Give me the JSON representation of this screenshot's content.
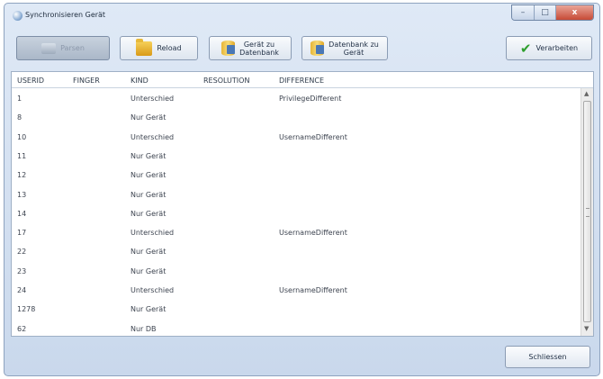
{
  "window": {
    "title": "Synchronisieren Gerät"
  },
  "titlebar": {
    "minimize": "–",
    "maximize": "□",
    "close": "x"
  },
  "toolbar": {
    "disabled_label": "Parsen",
    "reload_label": "Reload",
    "device_to_db_label": [
      "Gerät zu",
      "Datenbank"
    ],
    "db_to_device_label": [
      "Datenbank zu",
      "Gerät"
    ],
    "process_label": "Verarbeiten"
  },
  "table": {
    "headers": [
      "USERID",
      "FINGER",
      "KIND",
      "RESOLUTION",
      "DIFFERENCE"
    ],
    "rows": [
      {
        "userid": "1",
        "finger": "",
        "kind": "Unterschied",
        "resolution": "",
        "difference": "PrivilegeDifferent"
      },
      {
        "userid": "8",
        "finger": "",
        "kind": "Nur Gerät",
        "resolution": "",
        "difference": ""
      },
      {
        "userid": "10",
        "finger": "",
        "kind": "Unterschied",
        "resolution": "",
        "difference": "UsernameDifferent"
      },
      {
        "userid": "11",
        "finger": "",
        "kind": "Nur Gerät",
        "resolution": "",
        "difference": ""
      },
      {
        "userid": "12",
        "finger": "",
        "kind": "Nur Gerät",
        "resolution": "",
        "difference": ""
      },
      {
        "userid": "13",
        "finger": "",
        "kind": "Nur Gerät",
        "resolution": "",
        "difference": ""
      },
      {
        "userid": "14",
        "finger": "",
        "kind": "Nur Gerät",
        "resolution": "",
        "difference": ""
      },
      {
        "userid": "17",
        "finger": "",
        "kind": "Unterschied",
        "resolution": "",
        "difference": "UsernameDifferent"
      },
      {
        "userid": "22",
        "finger": "",
        "kind": "Nur Gerät",
        "resolution": "",
        "difference": ""
      },
      {
        "userid": "23",
        "finger": "",
        "kind": "Nur Gerät",
        "resolution": "",
        "difference": ""
      },
      {
        "userid": "24",
        "finger": "",
        "kind": "Unterschied",
        "resolution": "",
        "difference": "UsernameDifferent"
      },
      {
        "userid": "1278",
        "finger": "",
        "kind": "Nur Gerät",
        "resolution": "",
        "difference": ""
      },
      {
        "userid": "62",
        "finger": "",
        "kind": "Nur DB",
        "resolution": "",
        "difference": ""
      }
    ]
  },
  "footer": {
    "close_label": "Schliessen"
  },
  "icons": {
    "reload": "folder-icon",
    "device_to_db": "database-icon",
    "db_to_device": "database-icon",
    "process": "checkmark-icon"
  },
  "colors": {
    "accent": "#2e9f2e",
    "close_button": "#c74a36",
    "window_frame": "#c9d8ec"
  }
}
